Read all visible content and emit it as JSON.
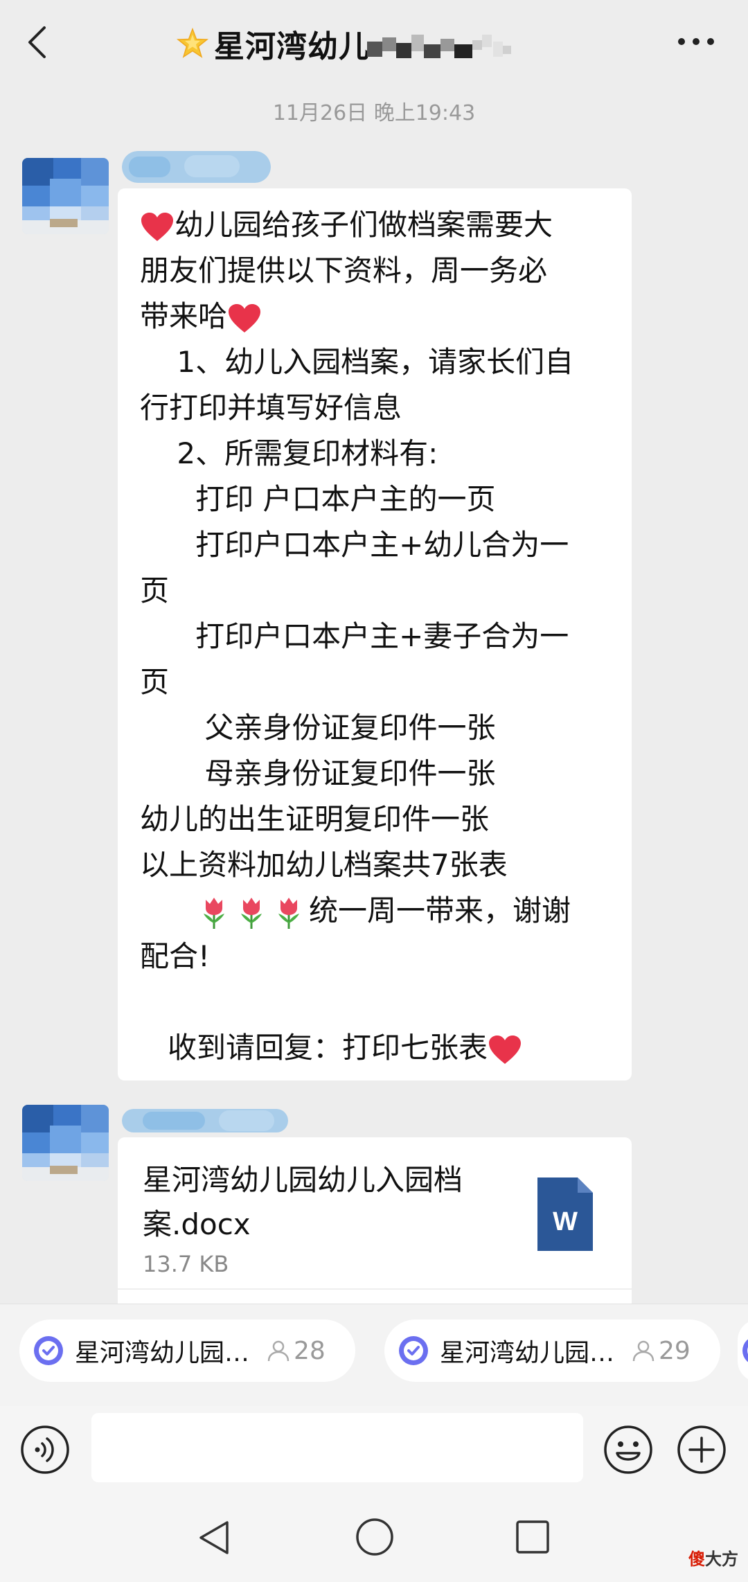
{
  "header": {
    "title": "星河湾幼儿",
    "title_emoji": "star-icon",
    "back_icon": "chevron-left-icon",
    "more_icon": "more-dots-icon"
  },
  "timestamp": "11月26日 晚上19:43",
  "message": {
    "lines": [
      "幼儿园给孩子们做档案需要大",
      "朋友们提供以下资料，周一务必",
      "带来哈",
      "    1、幼儿入园档案，请家长们自",
      "行打印并填写好信息",
      "    2、所需复印材料有:",
      "      打印 户口本户主的一页",
      "      打印户口本户主+幼儿合为一",
      "页",
      "      打印户口本户主+妻子合为一",
      "页",
      "       父亲身份证复印件一张",
      "       母亲身份证复印件一张",
      "幼儿的出生证明复印件一张",
      "以上资料加幼儿档案共7张表",
      "统一周一带来，谢谢",
      "配合!",
      "",
      "   收到请回复：打印七张表"
    ],
    "emoji_heart": "heart-icon",
    "emoji_tulip": "tulip-icon"
  },
  "file": {
    "name": "星河湾幼儿园幼儿入园档案.docx",
    "size": "13.7 KB",
    "icon": "word-doc-icon",
    "icon_letter": "W"
  },
  "groups": [
    {
      "name": "星河湾幼儿园…",
      "count": "28"
    },
    {
      "name": "星河湾幼儿园…",
      "count": "29"
    }
  ],
  "input": {
    "placeholder": ""
  },
  "watermark": {
    "part1": "傻",
    "part2": "大方"
  },
  "colors": {
    "background": "#ededed",
    "bubble": "#ffffff",
    "word_blue": "#2b5797",
    "heart_red": "#e8334a",
    "timestamp_gray": "#999999"
  }
}
